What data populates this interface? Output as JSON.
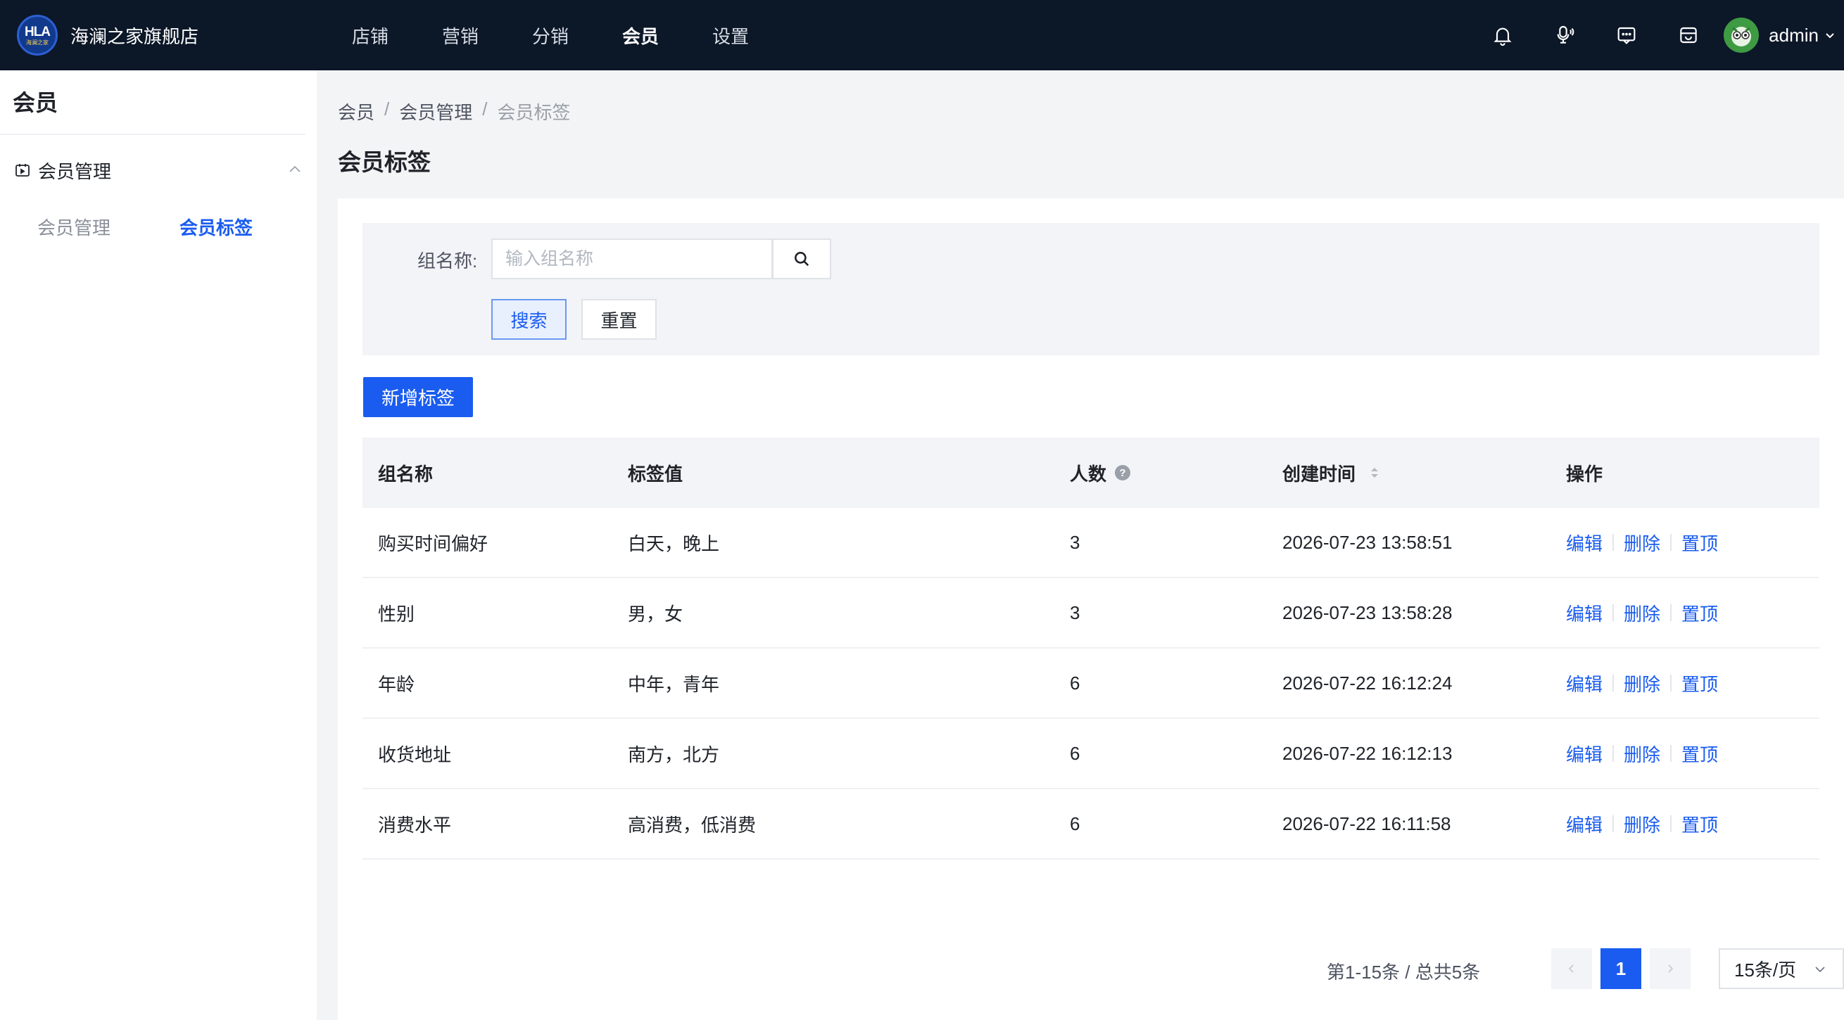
{
  "brand": {
    "logo_text": "HLA",
    "logo_sub": "海澜之家",
    "name": "海澜之家旗舰店"
  },
  "topnav": {
    "items": [
      {
        "label": "店铺"
      },
      {
        "label": "营销"
      },
      {
        "label": "分销"
      },
      {
        "label": "会员"
      },
      {
        "label": "设置"
      }
    ],
    "active": "会员"
  },
  "header_icons": [
    "bell-icon",
    "microphone-icon",
    "message-icon",
    "store-icon"
  ],
  "user": {
    "name": "admin"
  },
  "sidebar": {
    "title": "会员",
    "group": {
      "label": "会员管理",
      "expanded": true
    },
    "sub_items": [
      {
        "label": "会员管理"
      },
      {
        "label": "会员标签"
      }
    ],
    "active": "会员标签"
  },
  "breadcrumb": [
    "会员",
    "会员管理",
    "会员标签"
  ],
  "page_title": "会员标签",
  "search": {
    "label": "组名称:",
    "placeholder": "输入组名称",
    "value": "",
    "search_button": "搜索",
    "reset_button": "重置"
  },
  "add_button": "新增标签",
  "table": {
    "columns": [
      "组名称",
      "标签值",
      "人数",
      "创建时间",
      "操作"
    ],
    "rows": [
      {
        "group": "购买时间偏好",
        "tags": "白天，晚上",
        "count": "3",
        "created": "2026-07-23 13:58:51"
      },
      {
        "group": "性别",
        "tags": "男，女",
        "count": "3",
        "created": "2026-07-23 13:58:28"
      },
      {
        "group": "年龄",
        "tags": "中年，青年",
        "count": "6",
        "created": "2026-07-22 16:12:24"
      },
      {
        "group": "收货地址",
        "tags": "南方，北方",
        "count": "6",
        "created": "2026-07-22 16:12:13"
      },
      {
        "group": "消费水平",
        "tags": "高消费，低消费",
        "count": "6",
        "created": "2026-07-22 16:11:58"
      }
    ],
    "actions": {
      "edit": "编辑",
      "delete": "删除",
      "pin": "置顶"
    }
  },
  "pagination": {
    "summary": "第1-15条 / 总共5条",
    "current_page": "1",
    "page_size": "15条/页"
  },
  "colors": {
    "primary": "#1a5cf0",
    "topbar": "#0c1728"
  }
}
